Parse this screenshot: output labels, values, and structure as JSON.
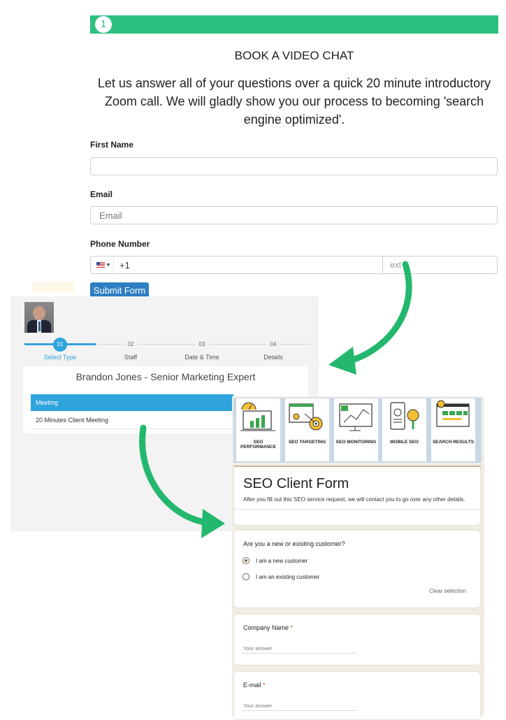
{
  "top_form": {
    "step_number": "1",
    "heading": "BOOK A VIDEO CHAT",
    "intro": "Let us answer all of your questions over a quick 20 minute introductory Zoom call. We will gladly show you our process to becoming 'search engine optimized'.",
    "first_name_label": "First Name",
    "first_name_value": "",
    "email_label": "Email",
    "email_placeholder": "Email",
    "phone_label": "Phone Number",
    "phone_value": "+1",
    "ext_placeholder": "ext",
    "submit_label": "Submit Form"
  },
  "booking": {
    "steps": [
      {
        "number": "01",
        "label": "Select Type"
      },
      {
        "number": "02",
        "label": "Staff"
      },
      {
        "number": "03",
        "label": "Date & Time"
      },
      {
        "number": "04",
        "label": "Details"
      }
    ],
    "expert": "Brandon Jones - Senior Marketing Expert",
    "category": "Meeting",
    "service": "20 Minutes Client Meeting"
  },
  "seo_form": {
    "tiles": [
      {
        "title": "SEO PERFORMANCE",
        "icon": "performance-gauge-icon"
      },
      {
        "title": "SEO TARGETING",
        "icon": "target-icon"
      },
      {
        "title": "SEO MONITORING",
        "icon": "monitor-chart-icon"
      },
      {
        "title": "MOBILE SEO",
        "icon": "mobile-search-icon"
      },
      {
        "title": "SEARCH RESULTS",
        "icon": "search-results-icon"
      }
    ],
    "title": "SEO Client Form",
    "subtitle": "After you fill out this SEO service request, we will contact you to go over any other details.",
    "question1": "Are you a new or existing customer?",
    "option_new": "I am a new customer",
    "option_existing": "I am an existing customer",
    "clear_selection": "Clear selection",
    "company_label": "Company Name",
    "email_label": "E-mail",
    "required_mark": "*",
    "answer_placeholder": "Your answer"
  },
  "colors": {
    "progress_green": "#2bc07e",
    "submit_blue": "#2d7fc1",
    "booking_blue": "#2fa3dc",
    "arrow_green": "#23b86e"
  }
}
